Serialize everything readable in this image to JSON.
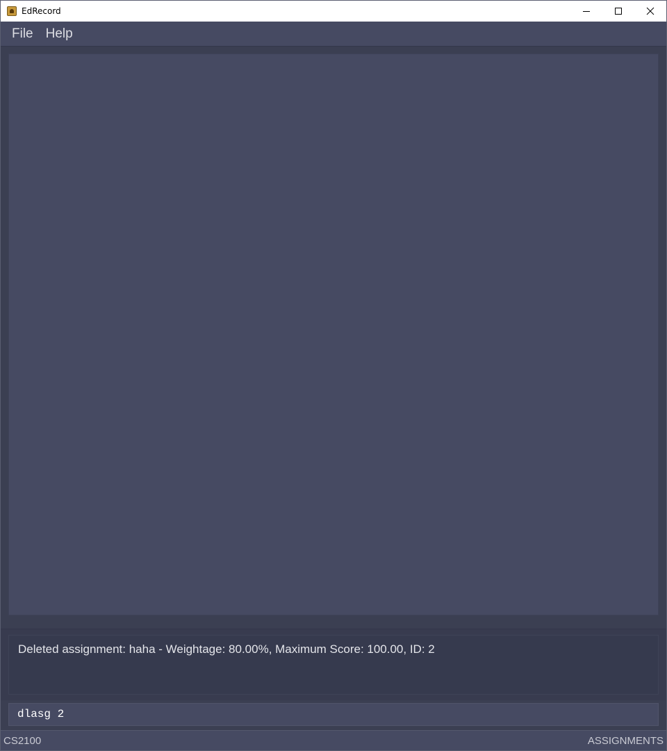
{
  "window": {
    "title": "EdRecord",
    "controls": [
      "minimize-icon",
      "maximize-icon",
      "close-icon"
    ]
  },
  "menu": {
    "items": [
      {
        "label": "File"
      },
      {
        "label": "Help"
      }
    ]
  },
  "result": {
    "message": "Deleted assignment: haha - Weightage: 80.00%, Maximum Score: 100.00, ID: 2"
  },
  "command": {
    "value": "dlasg 2"
  },
  "status": {
    "module": "CS2100",
    "view": "ASSIGNMENTS"
  },
  "colors": {
    "background": "#3b3f52",
    "panel": "#464a62",
    "titlebar": "#ffffff"
  }
}
